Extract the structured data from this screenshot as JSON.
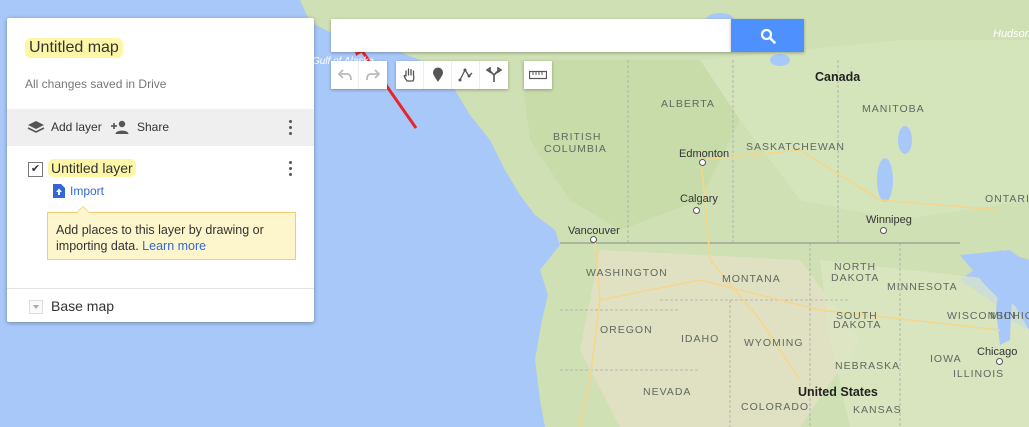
{
  "map": {
    "water_labels": [
      "Gulf of Alaska",
      "Hudson"
    ],
    "regions": [
      "ALBERTA",
      "BRITISH",
      "COLUMBIA",
      "SASKATCHEWAN",
      "MANITOBA",
      "ONTARIO",
      "WASHINGTON",
      "MONTANA",
      "NORTH",
      "DAKOTA",
      "MINNESOTA",
      "OREGON",
      "IDAHO",
      "SOUTH",
      "DAKOTA",
      "WYOMING",
      "WISCONSIN",
      "MICHIGAN",
      "NEBRASKA",
      "IOWA",
      "NEVADA",
      "ILLINOIS",
      "COLORADO",
      "KANSAS"
    ],
    "cities": [
      "Edmonton",
      "Calgary",
      "Vancouver",
      "Winnipeg",
      "Chicago"
    ],
    "countries": [
      "Canada",
      "United States"
    ]
  },
  "panel": {
    "title": "Untitled map",
    "saved_status": "All changes saved in Drive",
    "add_layer": "Add layer",
    "share": "Share",
    "layer_name": "Untitled layer",
    "layer_checked_glyph": "✔",
    "import": "Import",
    "tip_text": "Add places to this layer by drawing or importing data.",
    "tip_link": "Learn more",
    "base_map": "Base map"
  },
  "search": {
    "value": "",
    "placeholder": ""
  },
  "tools": [
    "undo-icon",
    "redo-icon",
    "hand-icon",
    "marker-icon",
    "draw-line-icon",
    "directions-icon",
    "ruler-icon"
  ],
  "annotation": {
    "arrow_color": "#e8262a"
  }
}
